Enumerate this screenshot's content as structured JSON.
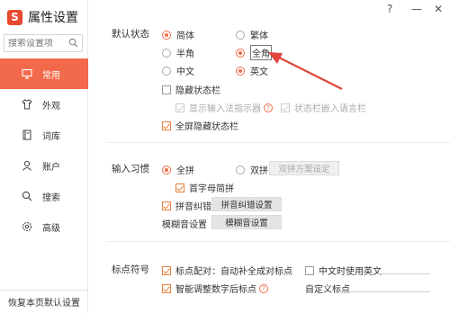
{
  "window": {
    "help": "?",
    "minimize": "—",
    "close": "✕"
  },
  "sidebar": {
    "title": "属性设置",
    "logo": "S",
    "search_placeholder": "搜索设置项",
    "items": [
      {
        "label": "常用",
        "icon": "monitor-icon",
        "active": true
      },
      {
        "label": "外观",
        "icon": "shirt-icon"
      },
      {
        "label": "词库",
        "icon": "book-icon"
      },
      {
        "label": "账户",
        "icon": "user-icon"
      },
      {
        "label": "搜索",
        "icon": "search-icon"
      },
      {
        "label": "高级",
        "icon": "gear-icon"
      }
    ],
    "restore_label": "恢复本页默认设置"
  },
  "status": {
    "label": "默认状态",
    "simplified": "简体",
    "traditional": "繁体",
    "halfwidth": "半角",
    "fullwidth": "全角",
    "chinese": "中文",
    "english": "英文",
    "hide_status_bar": "隐藏状态栏",
    "show_indicator": "显示输入法指示器",
    "statusbar_embed": "状态栏嵌入语言栏",
    "fullscreen_hide": "全屏隐藏状态栏"
  },
  "input": {
    "label": "输入习惯",
    "full_pinyin": "全拼",
    "double_pinyin": "双拼",
    "double_scheme_button": "双拼方案设定",
    "initial_simple": "首字母简拼",
    "pinyin_correction": "拼音纠错",
    "pinyin_correction_button": "拼音纠错设置",
    "fuzzy_label": "模糊音设置",
    "fuzzy_button": "模糊音设置"
  },
  "punct": {
    "label": "标点符号",
    "pairing": "标点配对：自动补全成对标点",
    "chinese_use_english": "中文时使用英文",
    "smart_adjust": "智能调整数字后标点",
    "custom": "自定义标点"
  },
  "colors": {
    "accent": "#f26a4b",
    "arrow": "#e2453c"
  }
}
